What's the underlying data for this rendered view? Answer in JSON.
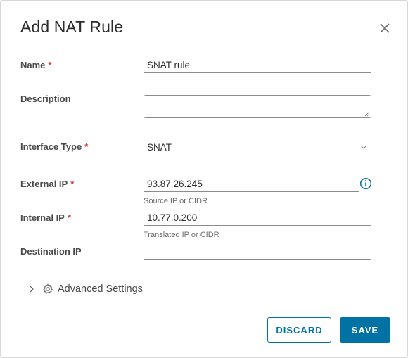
{
  "dialog": {
    "title": "Add NAT Rule",
    "close_icon": "close-icon"
  },
  "fields": {
    "name": {
      "label": "Name",
      "required_mark": "*",
      "value": "SNAT rule"
    },
    "description": {
      "label": "Description",
      "value": ""
    },
    "interface_type": {
      "label": "Interface Type",
      "required_mark": "*",
      "selected": "SNAT"
    },
    "external_ip": {
      "label": "External IP",
      "required_mark": "*",
      "value": "93.87.26.245",
      "helper": "Source IP or CIDR",
      "info_icon": "info-icon"
    },
    "internal_ip": {
      "label": "Internal IP",
      "required_mark": "*",
      "value": "10.77.0.200",
      "helper": "Translated IP or CIDR"
    },
    "destination_ip": {
      "label": "Destination IP",
      "value": ""
    }
  },
  "advanced": {
    "label": "Advanced Settings",
    "expand_icon": "chevron-right-icon",
    "settings_icon": "gear-icon"
  },
  "buttons": {
    "discard": "DISCARD",
    "save": "SAVE"
  },
  "colors": {
    "primary": "#0072a3",
    "required": "#d63b3b",
    "text": "#313131"
  }
}
